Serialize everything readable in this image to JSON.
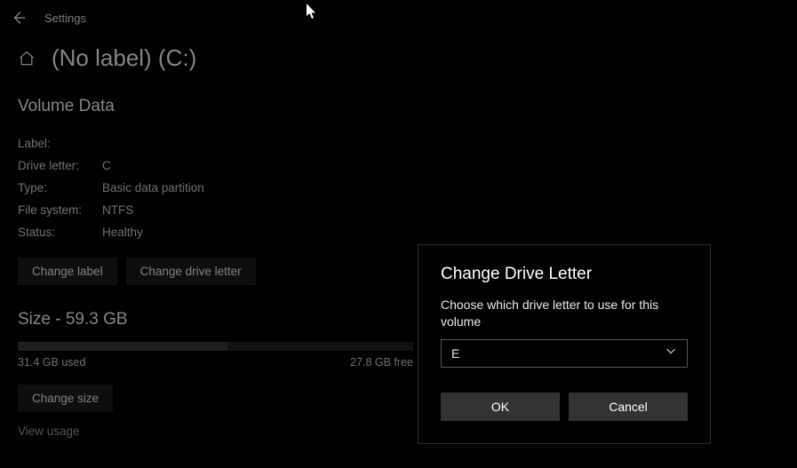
{
  "topbar": {
    "title": "Settings"
  },
  "header": {
    "title": "(No label) (C:)"
  },
  "volume": {
    "heading": "Volume Data",
    "rows": [
      {
        "key": "Label:",
        "val": ""
      },
      {
        "key": "Drive letter:",
        "val": "C"
      },
      {
        "key": "Type:",
        "val": "Basic data partition"
      },
      {
        "key": "File system:",
        "val": "NTFS"
      },
      {
        "key": "Status:",
        "val": "Healthy"
      }
    ],
    "change_label_btn": "Change label",
    "change_drive_letter_btn": "Change drive letter"
  },
  "size": {
    "heading": "Size - 59.3 GB",
    "used_pct": 53,
    "used_label": "31.4 GB used",
    "free_label": "27.8 GB free",
    "change_size_btn": "Change size",
    "view_usage_link": "View usage"
  },
  "dialog": {
    "title": "Change Drive Letter",
    "text": "Choose which drive letter to use for this volume",
    "selected": "E",
    "ok": "OK",
    "cancel": "Cancel"
  }
}
